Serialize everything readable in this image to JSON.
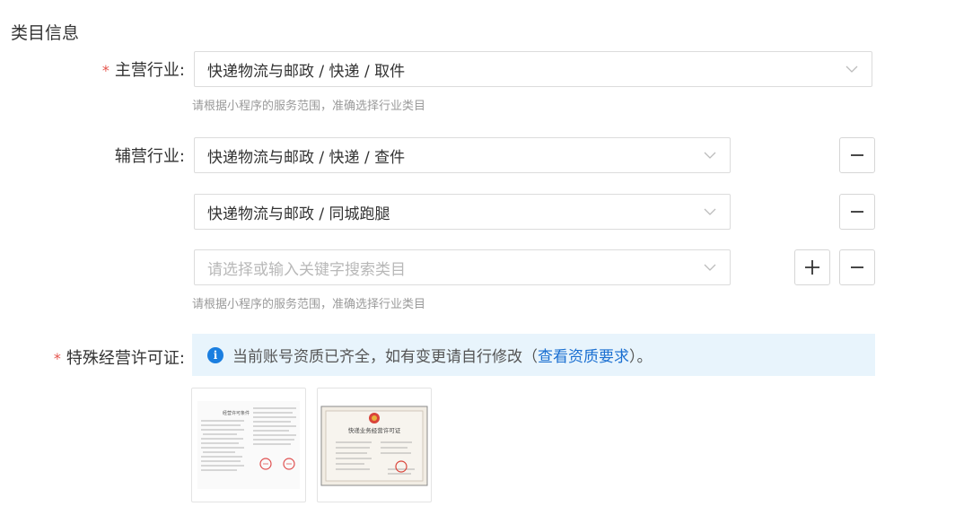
{
  "section": {
    "title": "类目信息"
  },
  "main_industry": {
    "required_mark": "*",
    "label": "主营行业:",
    "value": "快递物流与邮政 / 快递 / 取件",
    "hint": "请根据小程序的服务范围，准确选择行业类目"
  },
  "sub_industry": {
    "label": "辅营行业:",
    "items": [
      {
        "value": "快递物流与邮政 / 快递 / 查件"
      },
      {
        "value": "快递物流与邮政 / 同城跑腿"
      }
    ],
    "placeholder": "请选择或输入关键字搜索类目",
    "hint": "请根据小程序的服务范围，准确选择行业类目"
  },
  "license": {
    "required_mark": "*",
    "label": "特殊经营许可证:",
    "notice_prefix": "当前账号资质已齐全，如有变更请自行修改（",
    "notice_link": "查看资质要求",
    "notice_suffix": "）。",
    "doc1_title": "经营许可条件",
    "doc2_title": "快递业务经营许可证"
  },
  "colors": {
    "required": "#e5534b",
    "link": "#1a6fd1",
    "info_bg": "#e8f4fc",
    "info_icon": "#1a7ee0"
  },
  "icons": {
    "chevron": "chevron-down-icon",
    "minus": "minus-icon",
    "plus": "plus-icon",
    "info": "info-icon"
  }
}
